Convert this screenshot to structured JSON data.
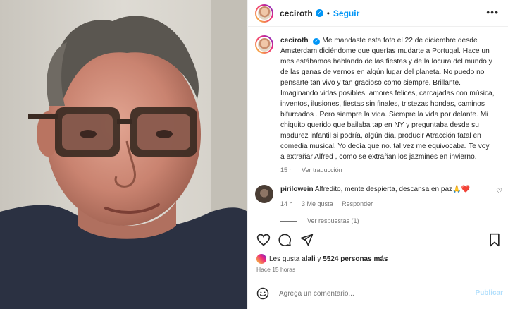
{
  "photo": {
    "alt": ""
  },
  "header": {
    "username": "ceciroth",
    "verified_mark": "✓",
    "separator": "•",
    "follow_label": "Seguir",
    "more_label": "•••"
  },
  "caption": {
    "username": "ceciroth",
    "text": "Me mandaste esta foto el 22 de diciembre desde Ámsterdam diciéndome que querías mudarte a Portugal. Hace un mes estábamos hablando de las fiestas y de la locura del mundo y de las ganas de vernos en algún lugar del planeta. No puedo no pensarte tan vivo y tan gracioso como siempre. Brillante. Imaginando vidas posibles, amores felices, carcajadas con música, inventos, ilusiones, fiestas sin finales, tristezas hondas, caminos bifurcados . Pero siempre la vida. Siempre la vida por delante. Mi chiquito querido que bailaba tap en NY y preguntaba desde su madurez infantil si podría, algún día, producir Atracción fatal en comedia musical. Yo decía que no. tal vez me equivocaba. Te voy a extrañar Alfred , como se extrañan los jazmines en invierno.",
    "time": "15 h",
    "translate": "Ver traducción"
  },
  "comment": {
    "username": "pirilowein",
    "text": "Alfredito, mente despierta, descansa en paz🙏❤️",
    "time": "14 h",
    "likes": "3 Me gusta",
    "reply": "Responder",
    "heart_icon": "♡",
    "view_replies": "Ver respuestas (1)"
  },
  "likes": {
    "prefix": "Les gusta a ",
    "first_user": "lali",
    "middle": " y ",
    "count": "5524 personas más"
  },
  "posted_ago": "Hace 15 horas",
  "add_comment": {
    "placeholder": "Agrega un comentario...",
    "emoji_icon": "smile-icon",
    "publish_label": "Publicar"
  },
  "colors": {
    "accent": "#0095f6",
    "publish_disabled": "#b2dffc",
    "muted": "#737373"
  }
}
